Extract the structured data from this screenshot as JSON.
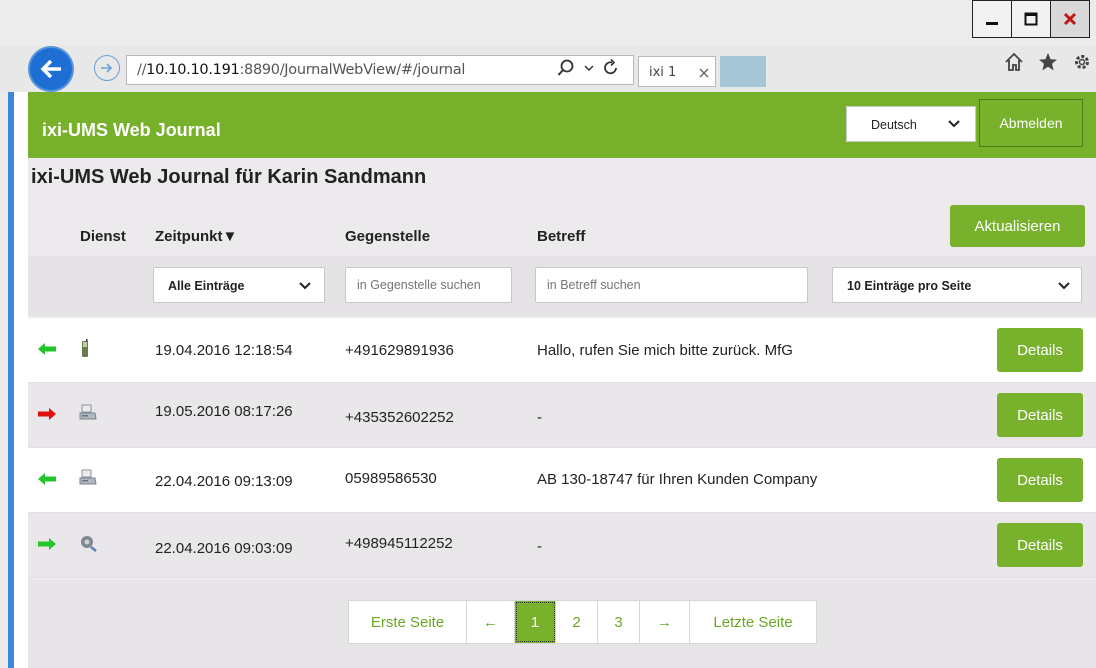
{
  "browser": {
    "url_prefix": "//",
    "url_host": "10.10.10.191",
    "url_rest": ":8890/JournalWebView/#/journal",
    "tab_label": "ixi 1",
    "window_buttons": [
      "minimize",
      "maximize",
      "close"
    ]
  },
  "header": {
    "app_title": "ixi-UMS Web Journal",
    "language": "Deutsch",
    "logout_label": "Abmelden",
    "accent": "#77b02a"
  },
  "page_title": "ixi-UMS Web Journal für Karin Sandmann",
  "columns": {
    "dienst": "Dienst",
    "zeitpunkt": "Zeitpunkt▼",
    "gegenstelle": "Gegenstelle",
    "betreff": "Betreff"
  },
  "refresh_label": "Aktualisieren",
  "filters": {
    "entries": "Alle Einträge",
    "gegenstelle_placeholder": "in Gegenstelle suchen",
    "betreff_placeholder": "in Betreff suchen",
    "per_page": "10 Einträge pro Seite"
  },
  "rows": [
    {
      "direction": "incoming",
      "service": "sms-icon",
      "time": "19.04.2016 12:18:54",
      "party": "+491629891936",
      "subject": "Hallo, rufen Sie mich bitte zurück. MfG",
      "details": "Details"
    },
    {
      "direction": "outgoing",
      "service": "fax-icon",
      "time": "19.05.2016 08:17:26",
      "party": "+435352602252",
      "subject": "-",
      "details": "Details"
    },
    {
      "direction": "incoming",
      "service": "fax-icon",
      "time": "22.04.2016 09:13:09",
      "party": "05989586530",
      "subject": "AB 130-18747 für Ihren Kunden Company",
      "details": "Details"
    },
    {
      "direction": "incoming",
      "service": "voice-icon",
      "time": "22.04.2016 09:03:09",
      "party": "+498945112252",
      "subject": "-",
      "details": "Details"
    }
  ],
  "pager": {
    "first": "Erste Seite",
    "prev": "←",
    "pages": [
      "1",
      "2",
      "3"
    ],
    "next": "→",
    "last": "Letzte Seite",
    "current": "1"
  }
}
